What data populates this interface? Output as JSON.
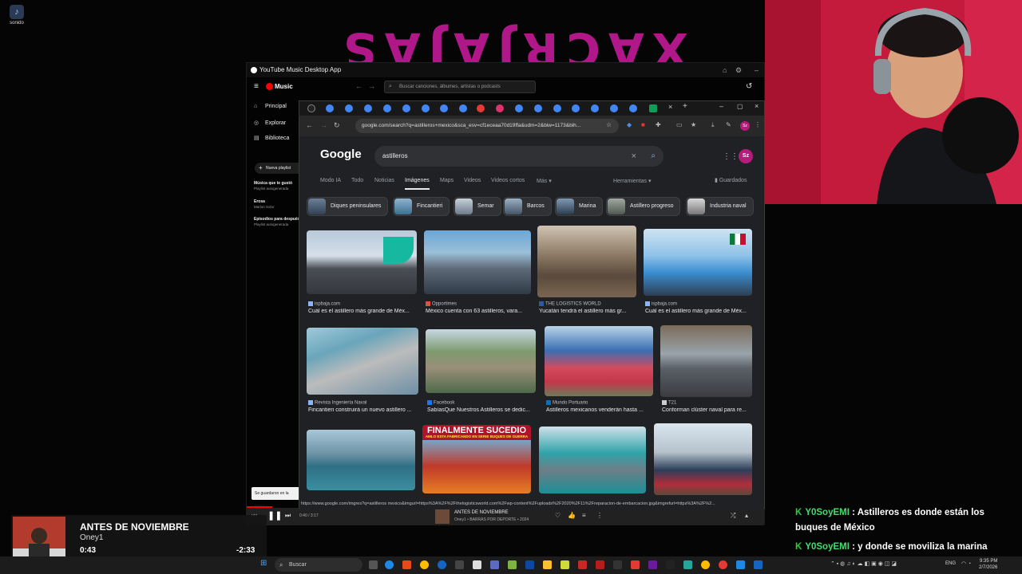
{
  "desktop": {
    "icon_label": "sonido",
    "stream_logo": "XACRJAJAS"
  },
  "ytm": {
    "window_title": "YouTube Music Desktop App",
    "logo": "Music",
    "search_placeholder": "Buscar canciones, álbumes, artistas o podcasts",
    "nav": [
      "Principal",
      "Explorar",
      "Biblioteca"
    ],
    "new_playlist": "Nueva playlist",
    "playlists": [
      {
        "name": "Música que te gustó",
        "sub": "Playlist autogenerada"
      },
      {
        "name": "Erosa",
        "sub": "Marlon Solor"
      },
      {
        "name": "Episodios para después",
        "sub": "Playlist autogenerada"
      }
    ],
    "toast": "Se guardaron en la música",
    "player": {
      "time": "0:40 / 3:17",
      "song": "ANTES DE NOVIEMBRE",
      "artist": "Oney1 • BARRAS POR DEPORTE • 2024"
    }
  },
  "chrome": {
    "url": "google.com/search?q=astilleros+mexico&sca_esv=cf1eceaa70d19ffa&udm=2&biw=1173&bih...",
    "status_url": "https://www.google.com/imgres?q=astilleros mexico&imgurl=https%3A%2F%2Fthelogisticsworld.com%2Fwp-content%2Fuploads%2F2020%2F11%2Freparacion-de-embarcacion.jpg&imgrefurl=https%3A%2F%2..."
  },
  "google": {
    "logo": "Google",
    "query": "astilleros",
    "avatar": "Sz",
    "tabs": [
      "Modo IA",
      "Todo",
      "Noticias",
      "Imágenes",
      "Maps",
      "Videos",
      "Videos cortos",
      "Más"
    ],
    "active_tab": "Imágenes",
    "tools": "Herramientas",
    "saved": "Guardados",
    "chips": [
      "Diques peninsulares",
      "Fincantieri",
      "Semar",
      "Barcos",
      "Marina",
      "Astillero progreso",
      "Industria naval"
    ],
    "results": [
      {
        "source": "ispbaja.com",
        "caption": "Cuál es el astillero más grande de Méx..."
      },
      {
        "source": "Opportimes",
        "caption": "México cuenta con 63 astilleros, vara..."
      },
      {
        "source": "THE LOGISTICS WORLD",
        "caption": "Yucatán tendrá el astillero más gr..."
      },
      {
        "source": "ispbaja.com",
        "caption": "Cuál es el astillero más grande de Méx..."
      },
      {
        "source": "Revista Ingeniería Naval",
        "caption": "Fincantieri construirá un nuevo astillero ..."
      },
      {
        "source": "Facebook",
        "caption": "SabíasQue Nuestros Astilleros se dedic..."
      },
      {
        "source": "Mundo Portuario",
        "caption": "Astilleros mexicanos venderán hasta ..."
      },
      {
        "source": "T21",
        "caption": "Conforman clúster naval para re..."
      }
    ],
    "banner_text": "FINALMENTE SUCEDIO",
    "banner_sub": "AMLO ESTA FABRICANDO EN SERIE BUQUES DE GUERRA"
  },
  "now_playing": {
    "title": "ANTES DE NOVIEMBRE",
    "artist": "Oney1",
    "current": "0:43",
    "remaining": "-2:33",
    "progress": 0.22
  },
  "chat": [
    {
      "user": "Y0SoyEMI",
      "text": ": Astilleros es donde están los buques de México"
    },
    {
      "user": "Y0SoyEMI",
      "text": ": y donde se moviliza la marina"
    }
  ],
  "taskbar": {
    "search": "Buscar",
    "lang": "ENG",
    "time": "9:35 PM",
    "date": "2/7/2026"
  }
}
